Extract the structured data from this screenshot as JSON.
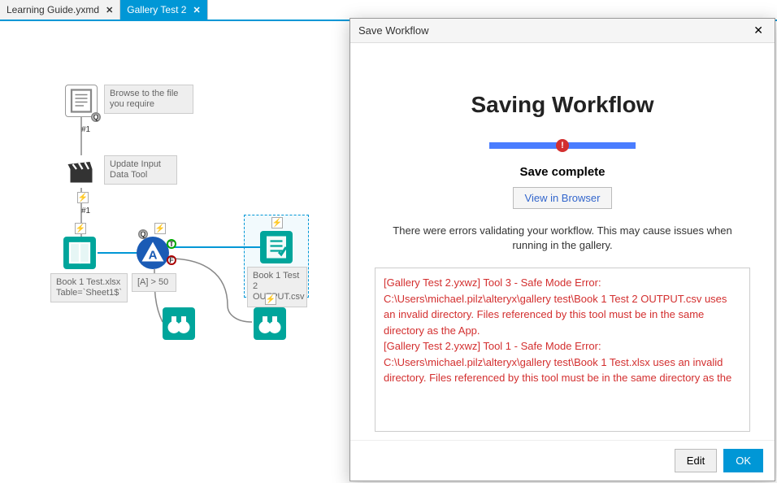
{
  "tabs": [
    {
      "label": "Learning Guide.yxmd",
      "active": false
    },
    {
      "label": "Gallery Test 2",
      "active": true
    }
  ],
  "canvas": {
    "browse_caption": "Browse to the file you require",
    "update_caption": "Update Input Data Tool",
    "input_label": "Book 1 Test.xlsx\nTable=`Sheet1$`",
    "filter_label": "[A] > 50",
    "output_label": "Book 1 Test 2 OUTPUT.csv",
    "anchor1": "#1",
    "anchor2": "#1",
    "q": "Q",
    "t": "T",
    "f": "F"
  },
  "dialog": {
    "title": "Save Workflow",
    "heading": "Saving Workflow",
    "status": "Save complete",
    "view_button": "View in Browser",
    "validation_message": "There were errors validating your workflow. This may cause issues when running in the gallery.",
    "errors": [
      "[Gallery Test 2.yxwz] Tool 3 - Safe Mode Error: C:\\Users\\michael.pilz\\alteryx\\gallery test\\Book 1 Test 2 OUTPUT.csv uses an invalid directory. Files referenced by this tool must be in the same directory as the App.",
      "[Gallery Test 2.yxwz] Tool 1 - Safe Mode Error: C:\\Users\\michael.pilz\\alteryx\\gallery test\\Book 1 Test.xlsx uses an invalid directory. Files referenced by this tool must be in the same directory as the"
    ],
    "edit_button": "Edit",
    "ok_button": "OK"
  },
  "colors": {
    "accent": "#0097d6",
    "teal": "#00a59b",
    "blue_tool": "#1a5bb5",
    "error": "#d32f2f"
  }
}
